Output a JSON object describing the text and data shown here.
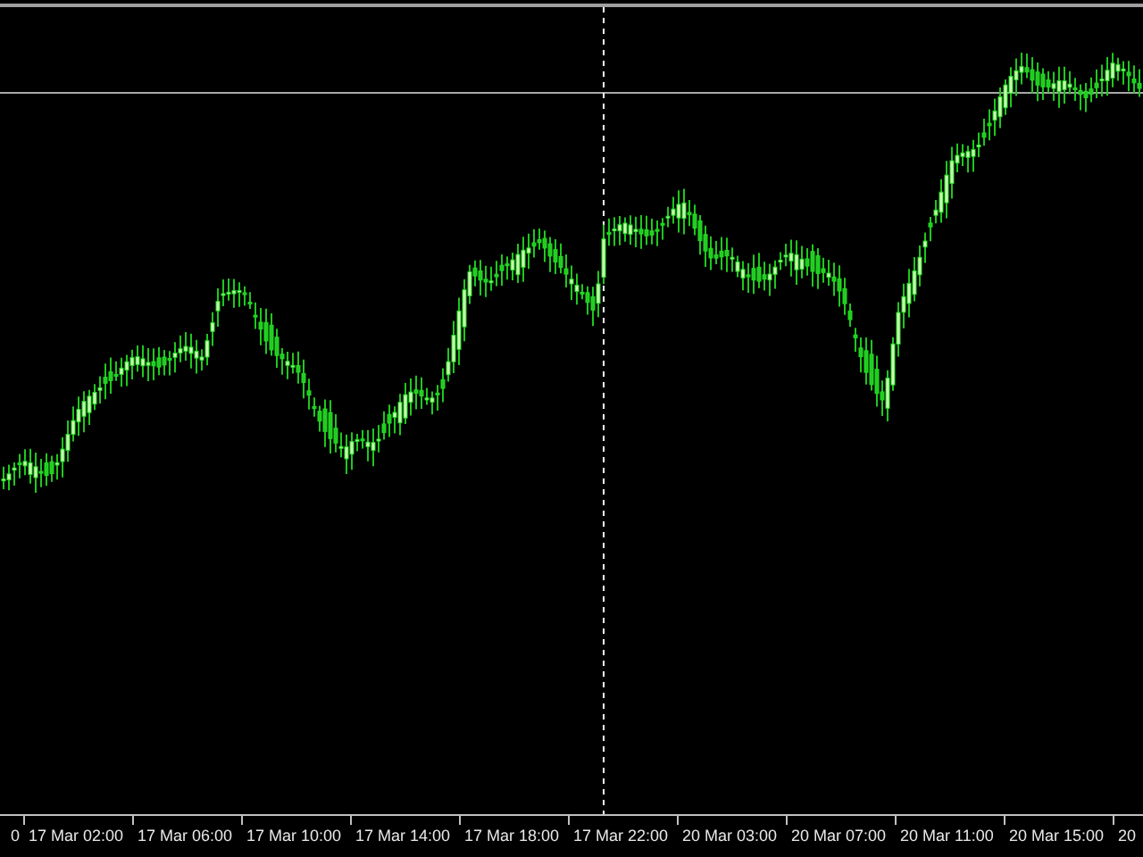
{
  "time_axis": {
    "labels": [
      "0",
      "17 Mar 02:00",
      "17 Mar 06:00",
      "17 Mar 10:00",
      "17 Mar 14:00",
      "17 Mar 18:00",
      "17 Mar 22:00",
      "20 Mar 03:00",
      "20 Mar 07:00",
      "20 Mar 11:00",
      "20 Mar 15:00",
      "20"
    ]
  }
}
